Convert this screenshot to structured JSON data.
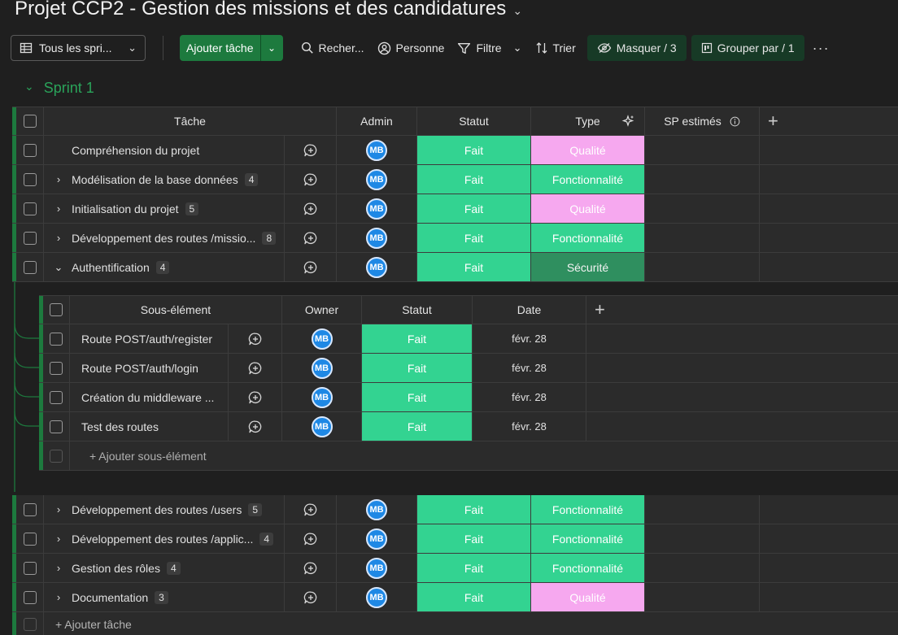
{
  "board": {
    "title": "Projet CCP2 - Gestion des missions et des candidatures"
  },
  "toolbar": {
    "view_label": "Tous les spri...",
    "add_task": "Ajouter tâche",
    "search": "Recher...",
    "person": "Personne",
    "filter": "Filtre",
    "sort": "Trier",
    "hide": "Masquer / 3",
    "group_by": "Grouper par / 1",
    "more": "···"
  },
  "group": {
    "name": "Sprint 1"
  },
  "columns": {
    "task": "Tâche",
    "admin": "Admin",
    "status": "Statut",
    "type": "Type",
    "sp": "SP estimés",
    "add": "+"
  },
  "tasks_top": [
    {
      "name": "Compréhension du projet",
      "count": "",
      "expand": "",
      "owner": "MB",
      "status": "Fait",
      "type": "Qualité",
      "type_color": "pink"
    },
    {
      "name": "Modélisation de la base données",
      "count": "4",
      "expand": "›",
      "owner": "MB",
      "status": "Fait",
      "type": "Fonctionnalité",
      "type_color": "green"
    },
    {
      "name": "Initialisation du projet",
      "count": "5",
      "expand": "›",
      "owner": "MB",
      "status": "Fait",
      "type": "Qualité",
      "type_color": "pink"
    },
    {
      "name": "Développement des routes /missio...",
      "count": "8",
      "expand": "›",
      "owner": "MB",
      "status": "Fait",
      "type": "Fonctionnalité",
      "type_color": "green"
    },
    {
      "name": "Authentification",
      "count": "4",
      "expand": "⌄",
      "owner": "MB",
      "status": "Fait",
      "type": "Sécurité",
      "type_color": "dkgreen"
    }
  ],
  "subitems": {
    "columns": {
      "name": "Sous-élément",
      "owner": "Owner",
      "status": "Statut",
      "date": "Date",
      "add": "+"
    },
    "rows": [
      {
        "name": "Route POST/auth/register",
        "owner": "MB",
        "status": "Fait",
        "date": "févr. 28"
      },
      {
        "name": "Route POST/auth/login",
        "owner": "MB",
        "status": "Fait",
        "date": "févr. 28"
      },
      {
        "name": "Création du middleware ...",
        "owner": "MB",
        "status": "Fait",
        "date": "févr. 28"
      },
      {
        "name": "Test des routes",
        "owner": "MB",
        "status": "Fait",
        "date": "févr. 28"
      }
    ],
    "add_label": "+ Ajouter sous-élément"
  },
  "tasks_bottom": [
    {
      "name": "Développement des routes /users",
      "count": "5",
      "owner": "MB",
      "status": "Fait",
      "type": "Fonctionnalité",
      "type_color": "green"
    },
    {
      "name": "Développement des routes /applic...",
      "count": "4",
      "owner": "MB",
      "status": "Fait",
      "type": "Fonctionnalité",
      "type_color": "green"
    },
    {
      "name": "Gestion des rôles",
      "count": "4",
      "owner": "MB",
      "status": "Fait",
      "type": "Fonctionnalité",
      "type_color": "green"
    },
    {
      "name": "Documentation",
      "count": "3",
      "owner": "MB",
      "status": "Fait",
      "type": "Qualité",
      "type_color": "pink"
    }
  ],
  "add_task_label": "+ Ajouter tâche",
  "colors": {
    "status_done": "#33d391",
    "quality": "#f6a8ef",
    "feature": "#33d391",
    "security": "#2f8f5f",
    "accent": "#1d7a3e"
  }
}
